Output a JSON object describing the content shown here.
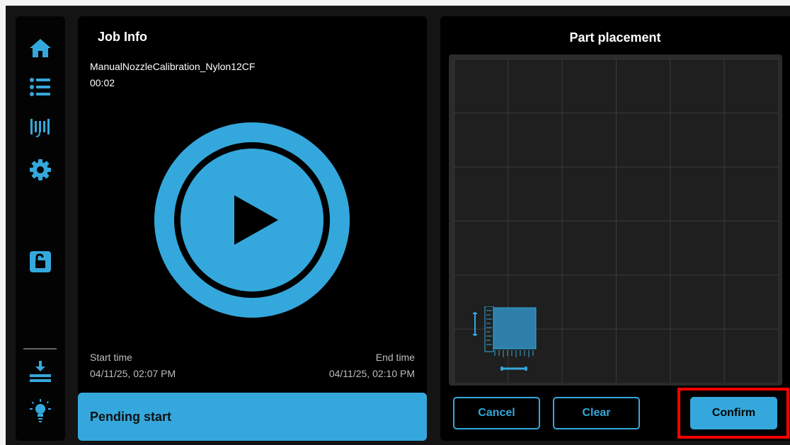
{
  "colors": {
    "accent": "#34a8dc",
    "highlight": "#ff0000"
  },
  "sidebar": {
    "items": [
      {
        "icon": "home-icon"
      },
      {
        "icon": "list-icon"
      },
      {
        "icon": "filament-icon"
      },
      {
        "icon": "gear-icon"
      },
      {
        "icon": "unlock-icon"
      },
      {
        "icon": "unload-icon"
      },
      {
        "icon": "light-icon"
      }
    ]
  },
  "job": {
    "title": "Job Info",
    "file_name": "ManualNozzleCalibration_Nylon12CF",
    "duration": "00:02",
    "start_label": "Start time",
    "start_value": "04/11/25, 02:07 PM",
    "end_label": "End time",
    "end_value": "04/11/25, 02:10 PM",
    "status": "Pending start"
  },
  "placement": {
    "title": "Part placement",
    "grid": {
      "rows": 6,
      "cols": 6
    },
    "buttons": {
      "cancel": "Cancel",
      "clear": "Clear",
      "confirm": "Confirm"
    }
  }
}
